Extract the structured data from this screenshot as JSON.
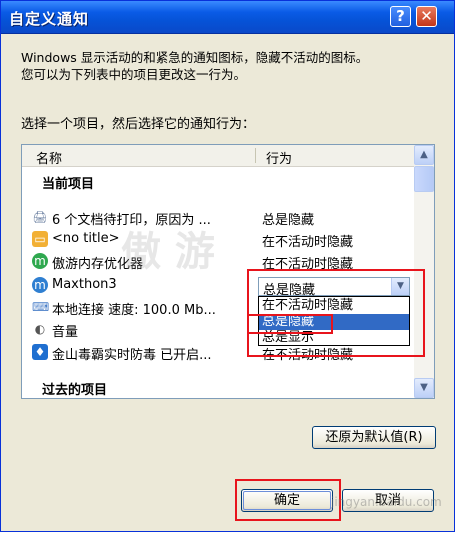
{
  "window": {
    "title": "自定义通知",
    "help_glyph": "?",
    "close_glyph": "✕"
  },
  "description": "Windows 显示活动的和紧急的通知图标，隐藏不活动的图标。\n您可以为下列表中的项目更改这一行为。",
  "prompt": "选择一个项目，然后选择它的通知行为：",
  "list": {
    "col_name": "名称",
    "col_action": "行为",
    "current_group": "当前项目",
    "past_group": "过去的项目",
    "items": [
      {
        "name": "6 个文档待打印，原因为 ...",
        "action": "总是隐藏",
        "icon": "printer-icon",
        "glyph": "🖨",
        "color": "#6a7fa0"
      },
      {
        "name": "<no title>",
        "action": "在不活动时隐藏",
        "icon": "window-icon",
        "glyph": "▭",
        "color": "#f2b035"
      },
      {
        "name": "傲游内存优化器",
        "action": "在不活动时隐藏",
        "icon": "maxthon-memory-icon",
        "glyph": "m",
        "color": "#2fa84f"
      },
      {
        "name": "Maxthon3",
        "action": "",
        "icon": "maxthon-icon",
        "glyph": "m",
        "color": "#2f7fd1"
      },
      {
        "name": "本地连接 速度: 100.0 Mb...",
        "action": "",
        "icon": "network-icon",
        "glyph": "⌨",
        "color": "#4b7fc8"
      },
      {
        "name": "音量",
        "action": "",
        "icon": "speaker-icon",
        "glyph": "◐",
        "color": "#555555"
      },
      {
        "name": "金山毒霸实时防毒 已开启...",
        "action": "在不活动时隐藏",
        "icon": "kingsoft-antivirus-icon",
        "glyph": "♦",
        "color": "#1f6fd0"
      }
    ],
    "combo_value": "总是隐藏",
    "dropdown_options": [
      "在不活动时隐藏",
      "总是隐藏",
      "总是显示"
    ]
  },
  "buttons": {
    "restore": "还原为默认值(R)",
    "ok": "确定",
    "cancel": "取消"
  },
  "watermark": {
    "big": "傲 游",
    "small": "jingyan.baidu.com"
  },
  "colors": {
    "titlebar": "#0a5be6",
    "selection": "#316ac5",
    "highlight_box": "#e8141c"
  }
}
